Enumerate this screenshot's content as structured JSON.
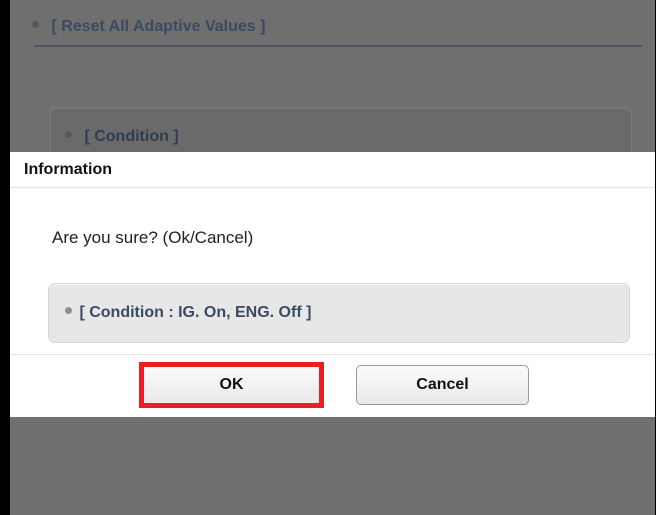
{
  "background": {
    "section_title": "[ Reset All Adaptive Values ]",
    "card_title": "[ Condition ]"
  },
  "dialog": {
    "title": "Information",
    "message": "Are you sure? (Ok/Cancel)",
    "condition": "[ Condition : IG. On, ENG. Off ]",
    "buttons": {
      "ok": "OK",
      "cancel": "Cancel"
    }
  },
  "annotation": {
    "highlight_color": "#ee1d24",
    "highlighted_target": "OK"
  },
  "colors": {
    "overlay_gray": "#6f6f6f",
    "dialog_white": "#ffffff",
    "condition_box": "#e7e7e7",
    "condition_text": "#3b4b65"
  }
}
